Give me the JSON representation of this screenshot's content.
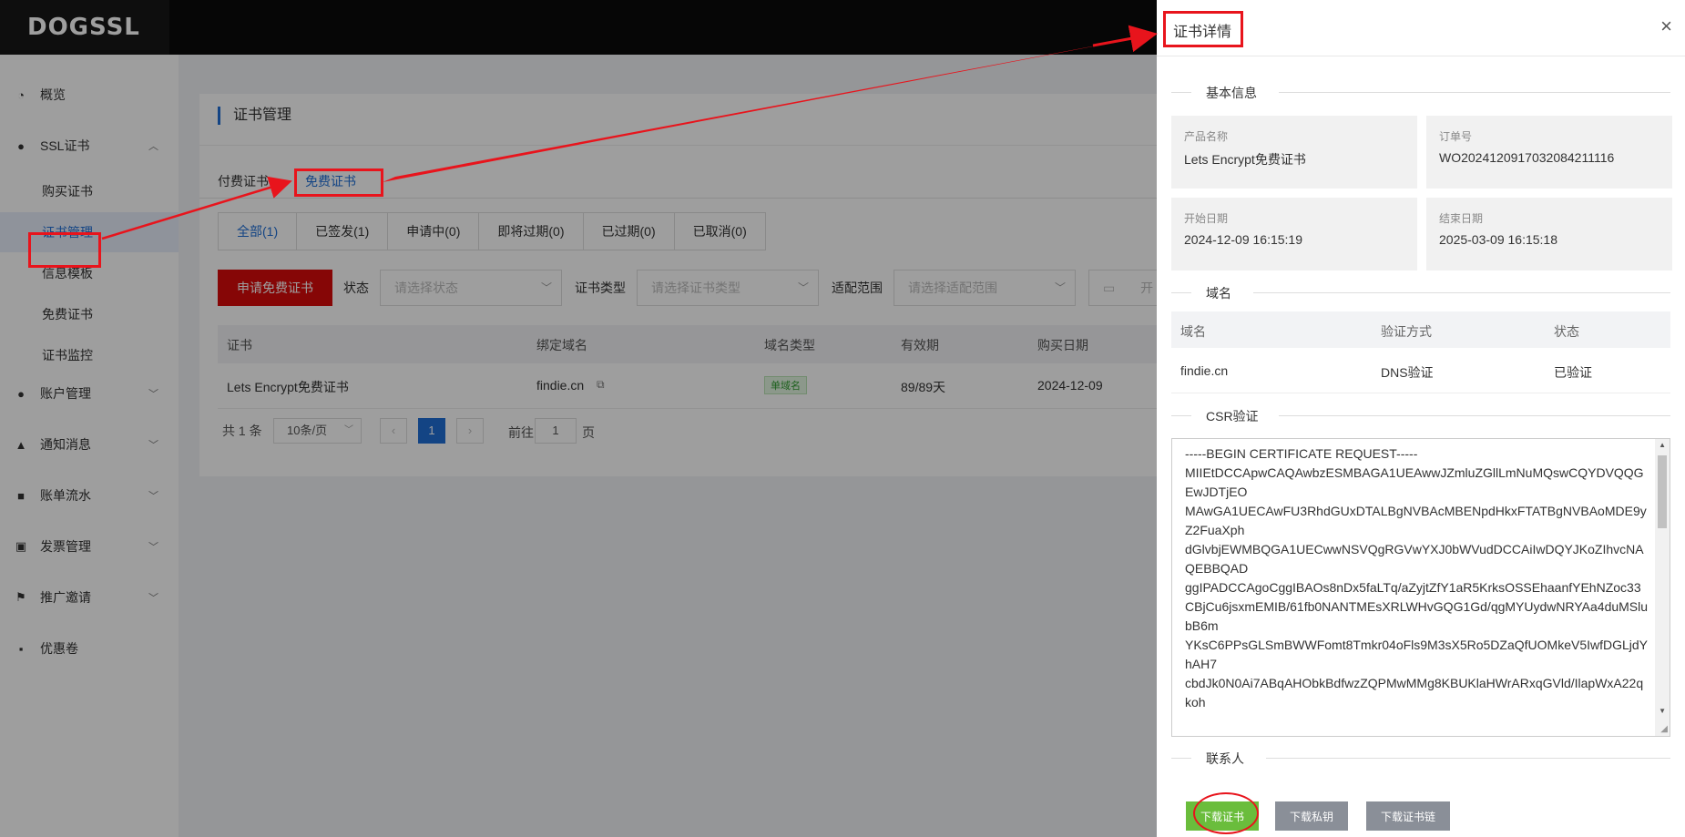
{
  "app": {
    "logo": "DOGSSL"
  },
  "sidebar": {
    "items": [
      {
        "label": "概览",
        "icon": "dashboard-icon",
        "glyph": "◔"
      },
      {
        "label": "SSL证书",
        "icon": "user-icon",
        "glyph": "●",
        "chevron": "︿"
      },
      {
        "label": "购买证书"
      },
      {
        "label": "证书管理"
      },
      {
        "label": "信息模板"
      },
      {
        "label": "免费证书"
      },
      {
        "label": "证书监控"
      },
      {
        "label": "账户管理",
        "icon": "person-icon",
        "glyph": "●",
        "chevron": "﹀"
      },
      {
        "label": "通知消息",
        "icon": "bell-icon",
        "glyph": "▲",
        "chevron": "﹀"
      },
      {
        "label": "账单流水",
        "icon": "wallet-icon",
        "glyph": "■",
        "chevron": "﹀"
      },
      {
        "label": "发票管理",
        "icon": "clipboard-icon",
        "glyph": "▣",
        "chevron": "﹀"
      },
      {
        "label": "推广邀请",
        "icon": "flag-icon",
        "glyph": "⚑",
        "chevron": "﹀"
      },
      {
        "label": "优惠卷",
        "icon": "bag-icon",
        "glyph": "▪"
      }
    ]
  },
  "main": {
    "title": "证书管理",
    "top_tabs": [
      "付费证书",
      "免费证书"
    ],
    "status_tabs": [
      "全部(1)",
      "已签发(1)",
      "申请中(0)",
      "即将过期(0)",
      "已过期(0)",
      "已取消(0)"
    ],
    "apply_button": "申请免费证书",
    "filters": {
      "status_label": "状态",
      "status_placeholder": "请选择状态",
      "type_label": "证书类型",
      "type_placeholder": "请选择证书类型",
      "scope_label": "适配范围",
      "scope_placeholder": "请选择适配范围",
      "date_partial": "开"
    },
    "table": {
      "headers": [
        "证书",
        "绑定域名",
        "域名类型",
        "有效期",
        "购买日期"
      ],
      "row": {
        "cert": "Lets Encrypt免费证书",
        "domain": "findie.cn",
        "domain_type": "单域名",
        "validity": "89/89天",
        "purchase_date": "2024-12-09"
      }
    },
    "pager": {
      "total": "共 1 条",
      "page_size": "10条/页",
      "current": "1",
      "goto_label": "前往",
      "goto_value": "1",
      "page_suffix": "页"
    }
  },
  "drawer": {
    "title": "证书详情",
    "close": "×",
    "basic_section": "基本信息",
    "fields": {
      "product_label": "产品名称",
      "product_value": "Lets Encrypt免费证书",
      "order_label": "订单号",
      "order_value": "WO20241209170320842111​16",
      "start_label": "开始日期",
      "start_value": "2024-12-09 16:15:19",
      "end_label": "结束日期",
      "end_value": "2025-03-09 16:15:18"
    },
    "domain_section": "域名",
    "domain_table": {
      "headers": [
        "域名",
        "验证方式",
        "状态"
      ],
      "row": [
        "findie.cn",
        "DNS验证",
        "已验证"
      ]
    },
    "csr_section": "CSR验证",
    "csr_text": "-----BEGIN CERTIFICATE REQUEST-----\nMIIEtDCCApwCAQAwbzESMBAGA1UEAwwJZmluZGllLmNuMQswCQYDVQQGEwJDTjEO\nMAwGA1UECAwFU3RhdGUxDTALBgNVBAcMBENpdHkxFTATBgNVBAoMDE9yZ2FuaXph\ndGlvbjEWMBQGA1UECwwNSVQgRGVwYXJ0bWVudDCCAiIwDQYJKoZIhvcNAQEBBQAD\nggIPADCCAgoCggIBAOs8nDx5faLTq/aZyjtZfY1aR5KrksOSSEhaanfYEhNZoc33\nCBjCu6jsxmEMIB/61fb0NANTMEsXRLWHvGQG1Gd/qgMYUydwNRYAa4duMSlubB6m\nYKsC6PPsGLSmBWWFomt8Tmkr04oFls9M3sX5Ro5DZaQfUOMkeV5IwfDGLjdYhAH7\ncbdJk0N0Ai7ABqAHObkBdfwzZQPMwMMg8KBUKlaHWrARxqGVld/IlapWxA22qkoh",
    "contact_section": "联系人",
    "buttons": [
      "下载证书",
      "下载私钥",
      "下载证书链"
    ]
  },
  "colors": {
    "accent": "#1f6fd6",
    "danger": "#d80b0b",
    "success": "#6abd3c",
    "annotation": "#e8141c"
  }
}
